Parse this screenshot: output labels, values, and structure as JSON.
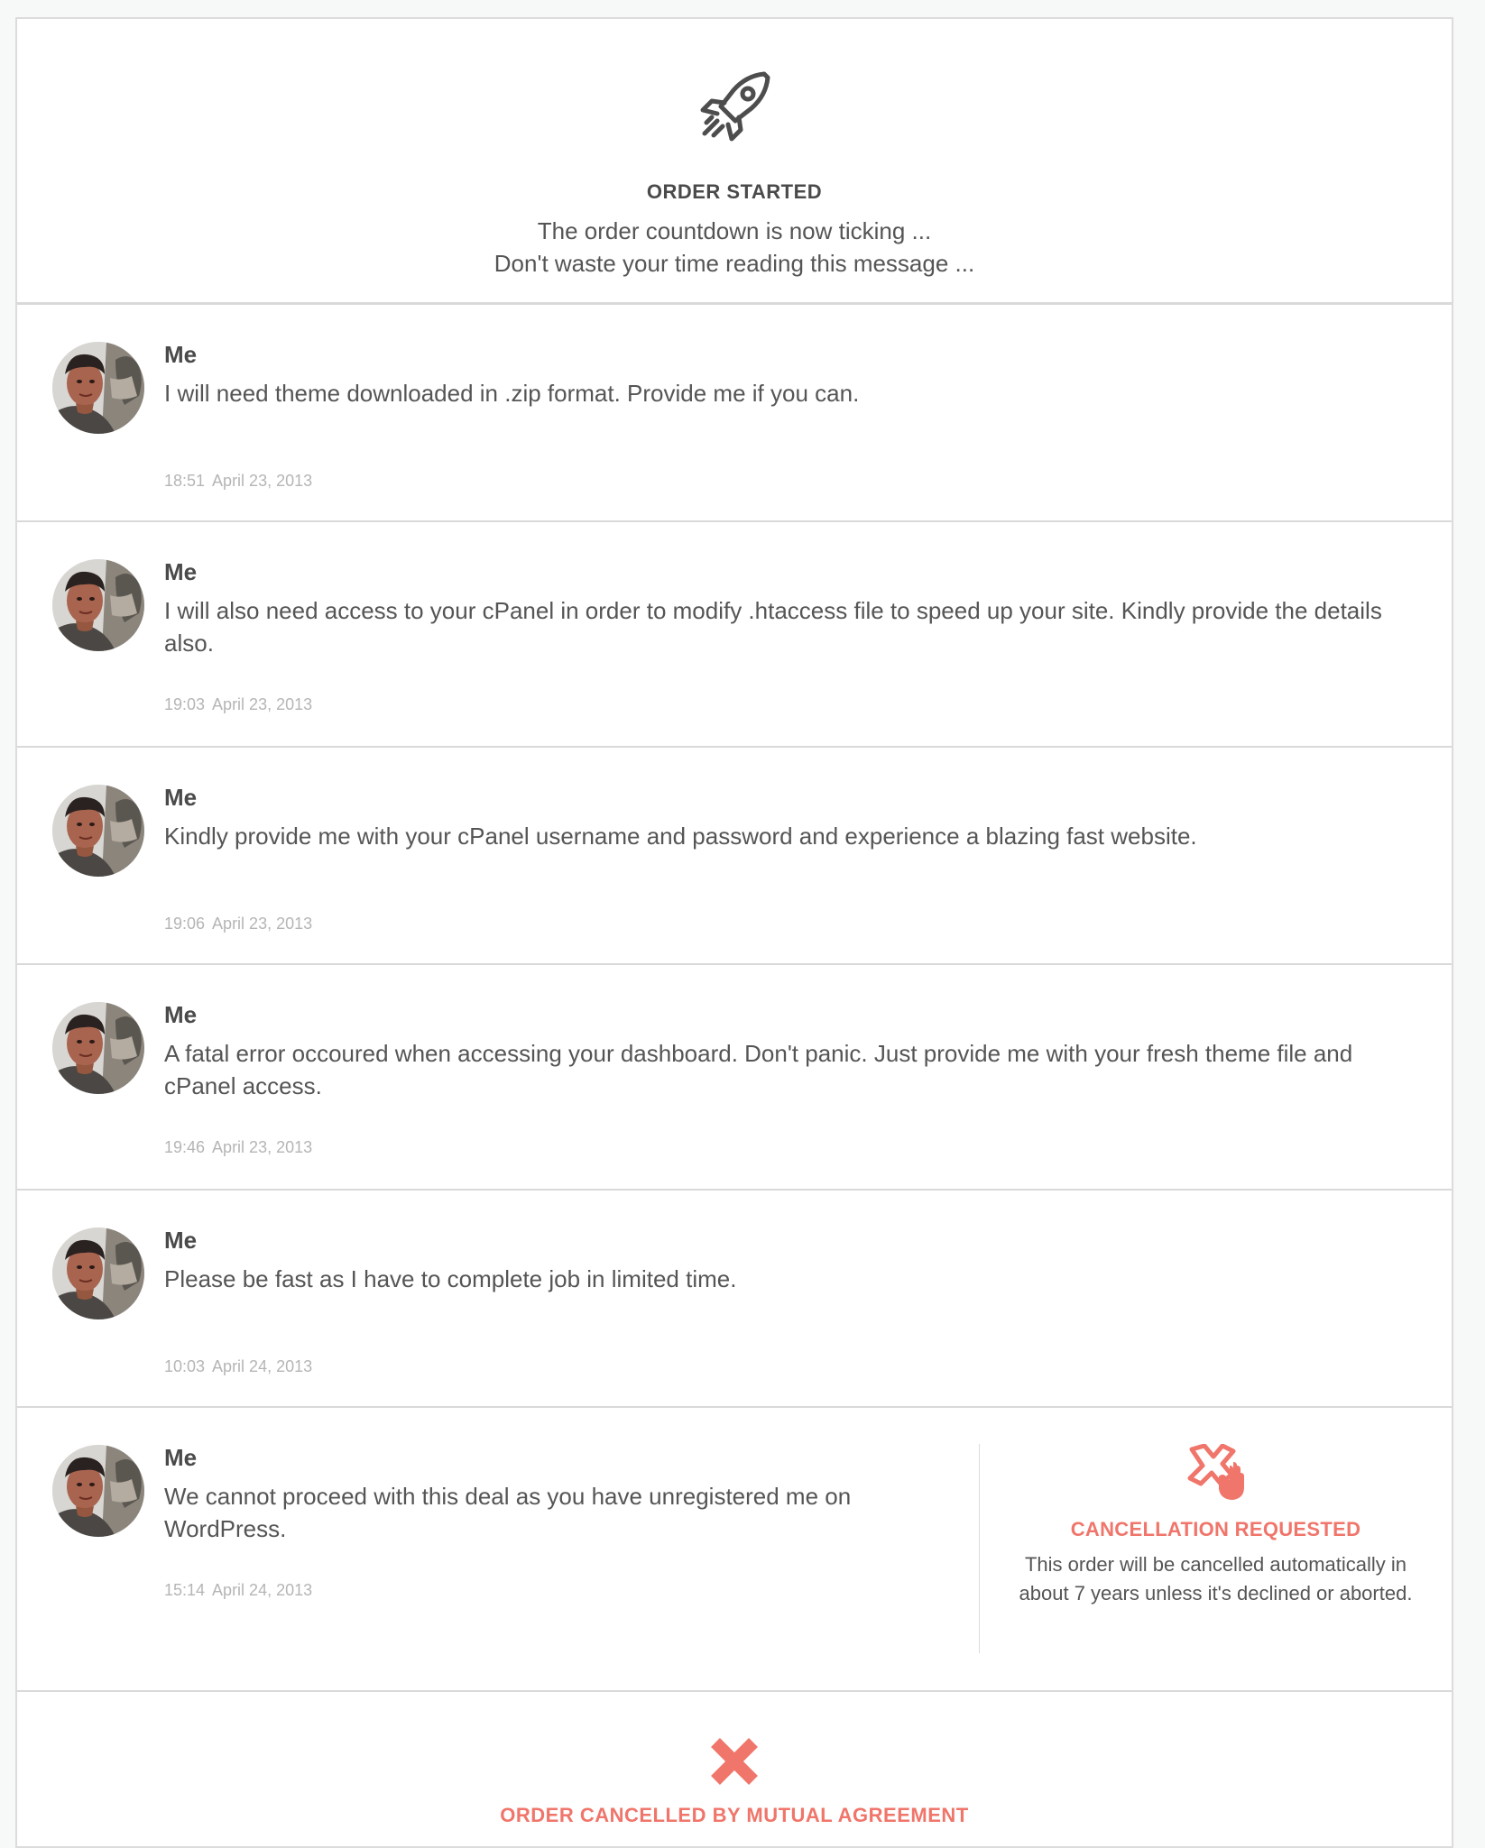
{
  "order_started": {
    "icon": "rocket-icon",
    "title": "ORDER STARTED",
    "line1": "The order countdown is now ticking ...",
    "line2": "Don't waste your time reading this message ..."
  },
  "messages": [
    {
      "author": "Me",
      "text": "I will need theme downloaded in .zip format. Provide me if you can.",
      "time": "18:51",
      "date": "April 23, 2013"
    },
    {
      "author": "Me",
      "text": "I will also need access to your cPanel in order to modify .htaccess file to speed up your site. Kindly provide the details also.",
      "time": "19:03",
      "date": "April 23, 2013"
    },
    {
      "author": "Me",
      "text": "Kindly provide me with your cPanel username and password and experience a blazing fast website.",
      "time": "19:06",
      "date": "April 23, 2013"
    },
    {
      "author": "Me",
      "text": "A fatal error occoured when accessing your dashboard. Don't panic. Just provide me with your fresh theme file and cPanel access.",
      "time": "19:46",
      "date": "April 23, 2013"
    },
    {
      "author": "Me",
      "text": "Please be fast as I have to complete job in limited time.",
      "time": "10:03",
      "date": "April 24, 2013"
    },
    {
      "author": "Me",
      "text": "We cannot proceed with this deal as you have unregistered me on WordPress.",
      "time": "15:14",
      "date": "April 24, 2013"
    }
  ],
  "cancellation_request": {
    "icon": "cancel-hand-icon",
    "title": "CANCELLATION REQUESTED",
    "text": "This order will be cancelled automatically in about 7 years unless it's declined or aborted."
  },
  "order_cancelled": {
    "icon": "x-icon",
    "title": "ORDER CANCELLED BY MUTUAL AGREEMENT"
  },
  "colors": {
    "accent_red": "#f0756a",
    "text": "#555555",
    "muted": "#b5b5b5",
    "border": "#d9d9d9"
  }
}
